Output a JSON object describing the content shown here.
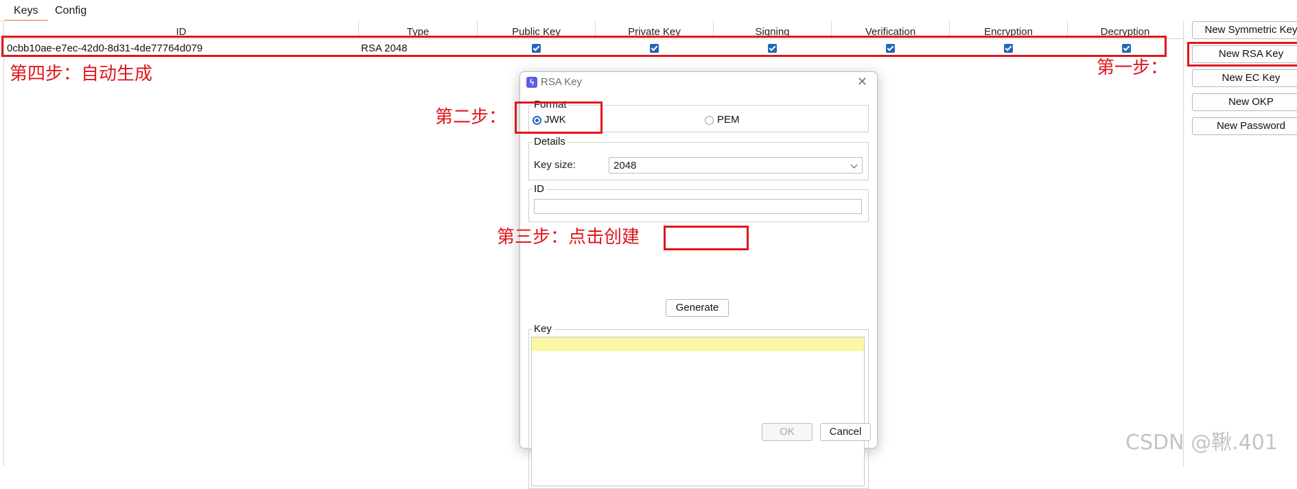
{
  "tabs": [
    "Keys",
    "Config"
  ],
  "table": {
    "columns": [
      "ID",
      "Type",
      "Public Key",
      "Private Key",
      "Signing",
      "Verification",
      "Encryption",
      "Decryption"
    ],
    "row": {
      "id": "0cbb10ae-e7ec-42d0-8d31-4de77764d079",
      "type": "RSA 2048",
      "public_key": true,
      "private_key": true,
      "signing": true,
      "verification": true,
      "encryption": true,
      "decryption": true
    }
  },
  "buttons": {
    "new_symmetric": "New Symmetric Key",
    "new_rsa": "New RSA Key",
    "new_ec": "New EC Key",
    "new_okp": "New OKP",
    "new_password": "New Password"
  },
  "dialog": {
    "title": "RSA Key",
    "format_label": "Format",
    "format_jwk": "JWK",
    "format_pem": "PEM",
    "format_selected": "JWK",
    "details_label": "Details",
    "key_size_label": "Key size:",
    "key_size_value": "2048",
    "id_label": "ID",
    "id_value": "",
    "generate_label": "Generate",
    "key_label": "Key",
    "key_value": "",
    "ok_label": "OK",
    "cancel_label": "Cancel"
  },
  "annotations": {
    "step1": "第一步：",
    "step2": "第二步：",
    "step3": "第三步：点击创建",
    "step4": "第四步：自动生成"
  },
  "watermark": "CSDN @鞦.401",
  "colors": {
    "annotation_red": "#e0151b",
    "checkbox_blue": "#2566b8",
    "tab_accent": "#e8692a"
  }
}
